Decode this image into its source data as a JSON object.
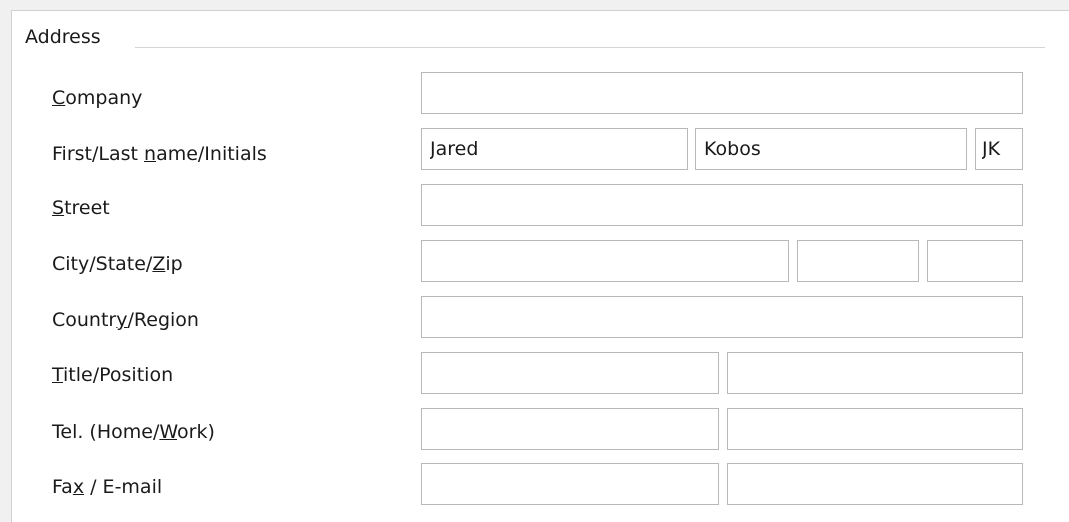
{
  "address": {
    "group_title": "Address",
    "company": {
      "label_pre": "",
      "label_mnemonic": "C",
      "label_post": "ompany",
      "value": ""
    },
    "name": {
      "label_pre": "First/Last ",
      "label_mnemonic": "n",
      "label_post": "ame/Initials",
      "first": "Jared",
      "last": "Kobos",
      "initials": "JK"
    },
    "street": {
      "label_pre": "",
      "label_mnemonic": "S",
      "label_post": "treet",
      "value": ""
    },
    "city_state_zip": {
      "label_pre": "City/State/",
      "label_mnemonic": "Z",
      "label_post": "ip",
      "city": "",
      "state": "",
      "zip": ""
    },
    "country": {
      "label_pre": "Countr",
      "label_mnemonic": "y",
      "label_post": "/Region",
      "value": ""
    },
    "title_position": {
      "label_pre": "",
      "label_mnemonic": "T",
      "label_post": "itle/Position",
      "title": "",
      "position": ""
    },
    "tel": {
      "label_pre": "Tel. (Home/",
      "label_mnemonic": "W",
      "label_post": "ork)",
      "home": "",
      "work": ""
    },
    "fax_email": {
      "label_pre": "Fa",
      "label_mnemonic": "x",
      "label_post": " / E-mail",
      "fax": "",
      "email": ""
    }
  }
}
